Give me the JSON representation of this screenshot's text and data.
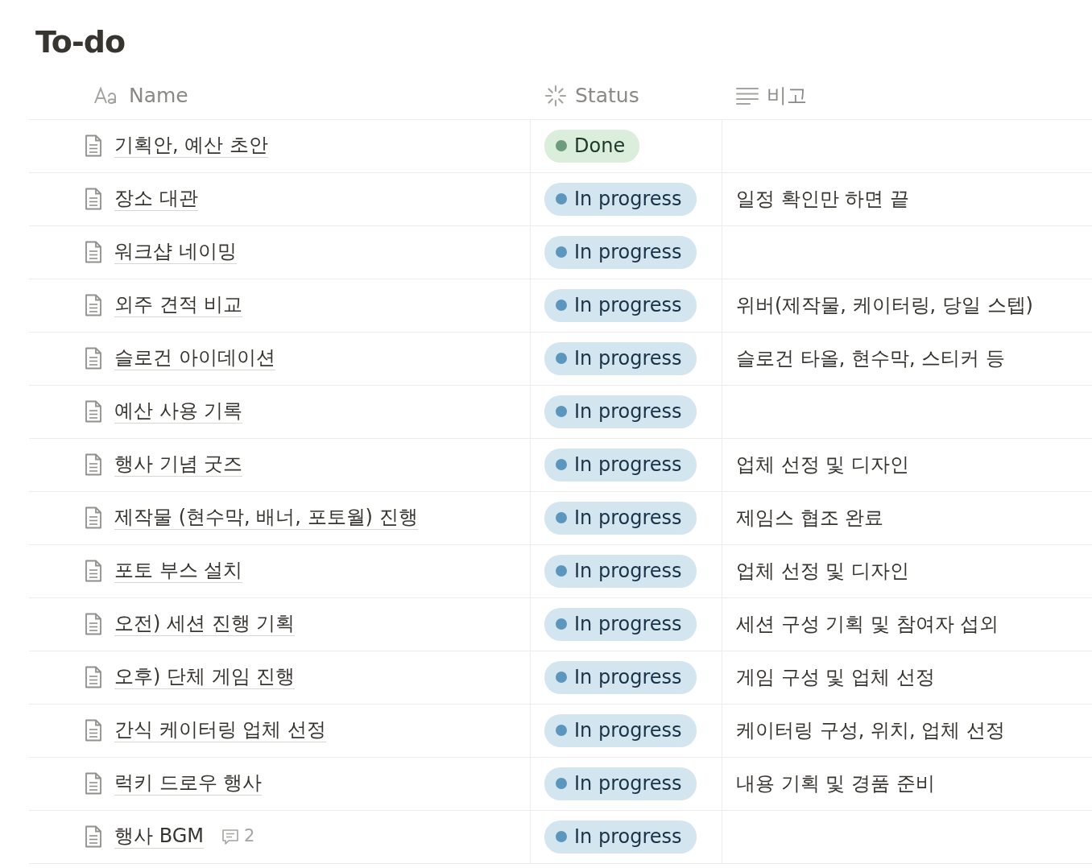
{
  "title": "To-do",
  "columns": [
    {
      "label": "Name",
      "kind": "title"
    },
    {
      "label": "Status",
      "kind": "status"
    },
    {
      "label": "비고",
      "kind": "text"
    }
  ],
  "rows": [
    {
      "name": "기획안, 예산 초안",
      "status": {
        "label": "Done",
        "kind": "done"
      }
    },
    {
      "name": "장소 대관",
      "status": {
        "label": "In progress",
        "kind": "in_progress"
      },
      "note": "일정 확인만 하면 끝"
    },
    {
      "name": "워크샵 네이밍",
      "status": {
        "label": "In progress",
        "kind": "in_progress"
      }
    },
    {
      "name": "외주 견적 비교",
      "status": {
        "label": "In progress",
        "kind": "in_progress"
      },
      "note": "위버(제작물, 케이터링, 당일 스텝)"
    },
    {
      "name": "슬로건 아이데이션",
      "status": {
        "label": "In progress",
        "kind": "in_progress"
      },
      "note": "슬로건 타올, 현수막, 스티커 등"
    },
    {
      "name": "예산 사용 기록",
      "status": {
        "label": "In progress",
        "kind": "in_progress"
      }
    },
    {
      "name": "행사 기념 굿즈",
      "status": {
        "label": "In progress",
        "kind": "in_progress"
      },
      "note": "업체 선정 및 디자인"
    },
    {
      "name": "제작물 (현수막, 배너, 포토월) 진행",
      "status": {
        "label": "In progress",
        "kind": "in_progress"
      },
      "note": "제임스 협조 완료"
    },
    {
      "name": "포토 부스 설치",
      "status": {
        "label": "In progress",
        "kind": "in_progress"
      },
      "note": "업체 선정 및 디자인"
    },
    {
      "name": "오전) 세션 진행 기획",
      "status": {
        "label": "In progress",
        "kind": "in_progress"
      },
      "note": "세션 구성 기획 및 참여자 섭외"
    },
    {
      "name": "오후) 단체 게임 진행",
      "status": {
        "label": "In progress",
        "kind": "in_progress"
      },
      "note": "게임 구성 및 업체 선정"
    },
    {
      "name": "간식 케이터링 업체 선정",
      "status": {
        "label": "In progress",
        "kind": "in_progress"
      },
      "note": "케이터링 구성, 위치, 업체 선정"
    },
    {
      "name": "럭키 드로우 행사",
      "status": {
        "label": "In progress",
        "kind": "in_progress"
      },
      "note": "내용 기획 및 경품 준비"
    },
    {
      "name": "행사 BGM",
      "comments": "2",
      "status": {
        "label": "In progress",
        "kind": "in_progress"
      }
    }
  ]
}
